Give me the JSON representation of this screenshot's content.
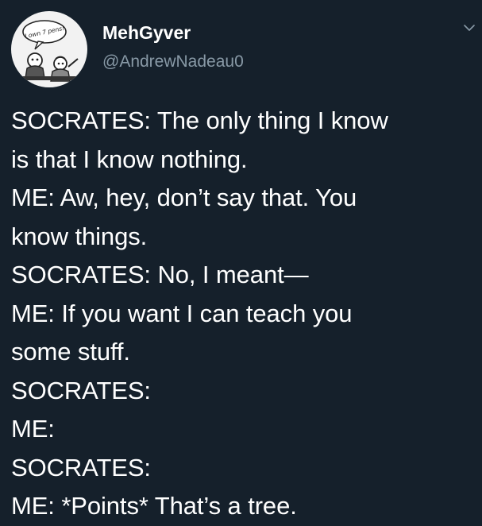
{
  "tweet": {
    "author": {
      "display_name": "MehGyver",
      "handle": "@AndrewNadeau0",
      "avatar_caption": "I own 7 pens!",
      "avatar_icon": "comic-avatar-icon"
    },
    "menu_icon": "chevron-down-icon",
    "body_lines": [
      "SOCRATES: The only thing I know",
      "is that I know nothing.",
      "ME: Aw, hey, don’t say that. You",
      "know things.",
      "SOCRATES: No, I meant—",
      "ME: If you want I can teach you",
      "some stuff.",
      "SOCRATES:",
      "ME:",
      "SOCRATES:",
      "ME: *Points* That’s a tree."
    ]
  },
  "colors": {
    "background": "#15202b",
    "text": "#ffffff",
    "secondary_text": "#8899a6"
  }
}
